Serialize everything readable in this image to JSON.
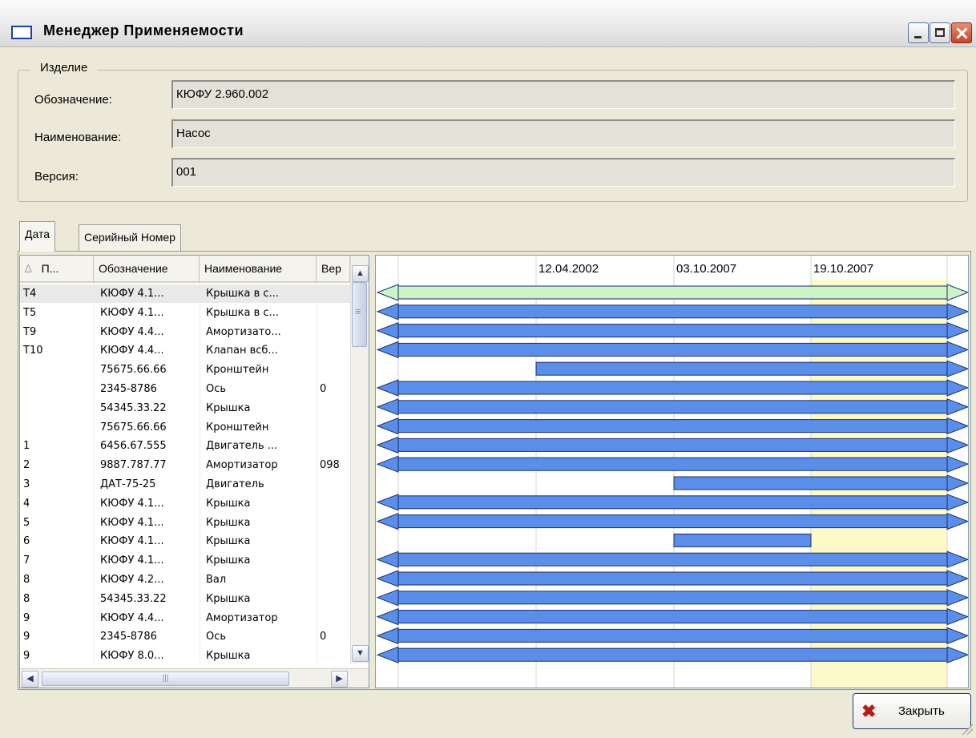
{
  "window": {
    "title": "Менеджер Применяемости"
  },
  "product": {
    "legend": "Изделие",
    "designation_label": "Обозначение:",
    "designation_value": "КЮФУ 2.960.002",
    "name_label": "Наименование:",
    "name_value": "Насос",
    "version_label": "Версия:",
    "version_value": "001"
  },
  "tabs": [
    {
      "label": "Дата"
    },
    {
      "label": "Серийный Номер"
    }
  ],
  "table": {
    "columns": [
      "П...",
      "Обозначение",
      "Наименование",
      "Вер"
    ],
    "rows": [
      {
        "pos": "T4",
        "designation": "КЮФУ 4.1...",
        "name": "Крышка в с...",
        "ver": ""
      },
      {
        "pos": "T5",
        "designation": "КЮФУ 4.1...",
        "name": "Крышка в с...",
        "ver": ""
      },
      {
        "pos": "T9",
        "designation": "КЮФУ 4.4...",
        "name": "Амортизато...",
        "ver": ""
      },
      {
        "pos": "T10",
        "designation": "КЮФУ 4.4...",
        "name": "Клапан всб...",
        "ver": ""
      },
      {
        "pos": "",
        "designation": "75675.66.66",
        "name": "Кронштейн",
        "ver": ""
      },
      {
        "pos": "",
        "designation": "2345-8786",
        "name": "Ось",
        "ver": "0"
      },
      {
        "pos": "",
        "designation": "54345.33.22",
        "name": "Крышка",
        "ver": ""
      },
      {
        "pos": "",
        "designation": "75675.66.66",
        "name": "Кронштейн",
        "ver": ""
      },
      {
        "pos": "1",
        "designation": "6456.67.555",
        "name": "Двигатель ...",
        "ver": ""
      },
      {
        "pos": "2",
        "designation": "9887.787.77",
        "name": "Амортизатор",
        "ver": "098"
      },
      {
        "pos": "3",
        "designation": "ДАТ-75-25",
        "name": "Двигатель",
        "ver": ""
      },
      {
        "pos": "4",
        "designation": "КЮФУ 4.1...",
        "name": "Крышка",
        "ver": ""
      },
      {
        "pos": "5",
        "designation": "КЮФУ 4.1...",
        "name": "Крышка",
        "ver": ""
      },
      {
        "pos": "6",
        "designation": "КЮФУ 4.1...",
        "name": "Крышка",
        "ver": ""
      },
      {
        "pos": "7",
        "designation": "КЮФУ 4.1...",
        "name": "Крышка",
        "ver": ""
      },
      {
        "pos": "8",
        "designation": "КЮФУ 4.2...",
        "name": "Вал",
        "ver": ""
      },
      {
        "pos": "8",
        "designation": "54345.33.22",
        "name": "Крышка",
        "ver": ""
      },
      {
        "pos": "9",
        "designation": "КЮФУ 4.4...",
        "name": "Амортизатор",
        "ver": ""
      },
      {
        "pos": "9",
        "designation": "2345-8786",
        "name": "Ось",
        "ver": "0"
      },
      {
        "pos": "9",
        "designation": "КЮФУ 8.0...",
        "name": "Крышка",
        "ver": ""
      }
    ]
  },
  "timeline": {
    "dates": [
      "12.04.2002",
      "03.10.2007",
      "19.10.2007"
    ],
    "bar_color": "#5b8ee8",
    "selected_bar_color": "#cdf3c7",
    "highlight_color": "#fdf9c8",
    "bars": [
      {
        "start": null,
        "end": null
      },
      {
        "start": null,
        "end": null
      },
      {
        "start": null,
        "end": null
      },
      {
        "start": null,
        "end": null
      },
      {
        "start": "12.04.2002",
        "end": null
      },
      {
        "start": null,
        "end": null
      },
      {
        "start": null,
        "end": null
      },
      {
        "start": null,
        "end": null
      },
      {
        "start": null,
        "end": null
      },
      {
        "start": null,
        "end": null
      },
      {
        "start": "03.10.2007",
        "end": null
      },
      {
        "start": null,
        "end": null
      },
      {
        "start": null,
        "end": null
      },
      {
        "start": "03.10.2007",
        "end": "19.10.2007"
      },
      {
        "start": null,
        "end": null
      },
      {
        "start": null,
        "end": null
      },
      {
        "start": null,
        "end": null
      },
      {
        "start": null,
        "end": null
      },
      {
        "start": null,
        "end": null
      },
      {
        "start": null,
        "end": null
      }
    ]
  },
  "buttons": {
    "close_label": "Закрыть"
  }
}
